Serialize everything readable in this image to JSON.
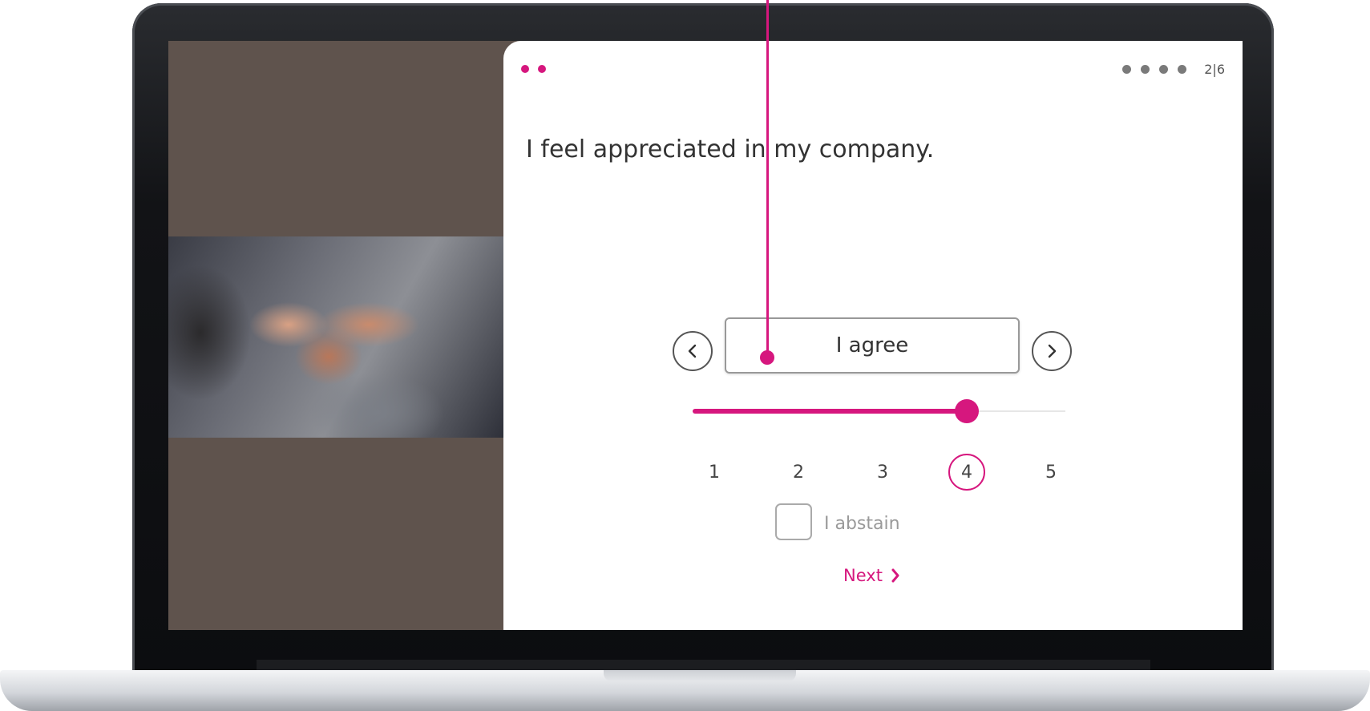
{
  "survey": {
    "progress_text": "2|6",
    "question": "I feel appreciated  in my company.",
    "answer_label": "I agree",
    "scale": [
      {
        "value": "1"
      },
      {
        "value": "2"
      },
      {
        "value": "3"
      },
      {
        "value": "4"
      },
      {
        "value": "5"
      }
    ],
    "selected_value": 4,
    "abstain_label": "I abstain",
    "next_label": "Next"
  },
  "icons": {
    "prev": "chevron-left-icon",
    "next": "chevron-right-icon",
    "next_link": "chevron-right-icon"
  },
  "colors": {
    "accent": "#d6177e",
    "panel_background": "#5f534d"
  }
}
